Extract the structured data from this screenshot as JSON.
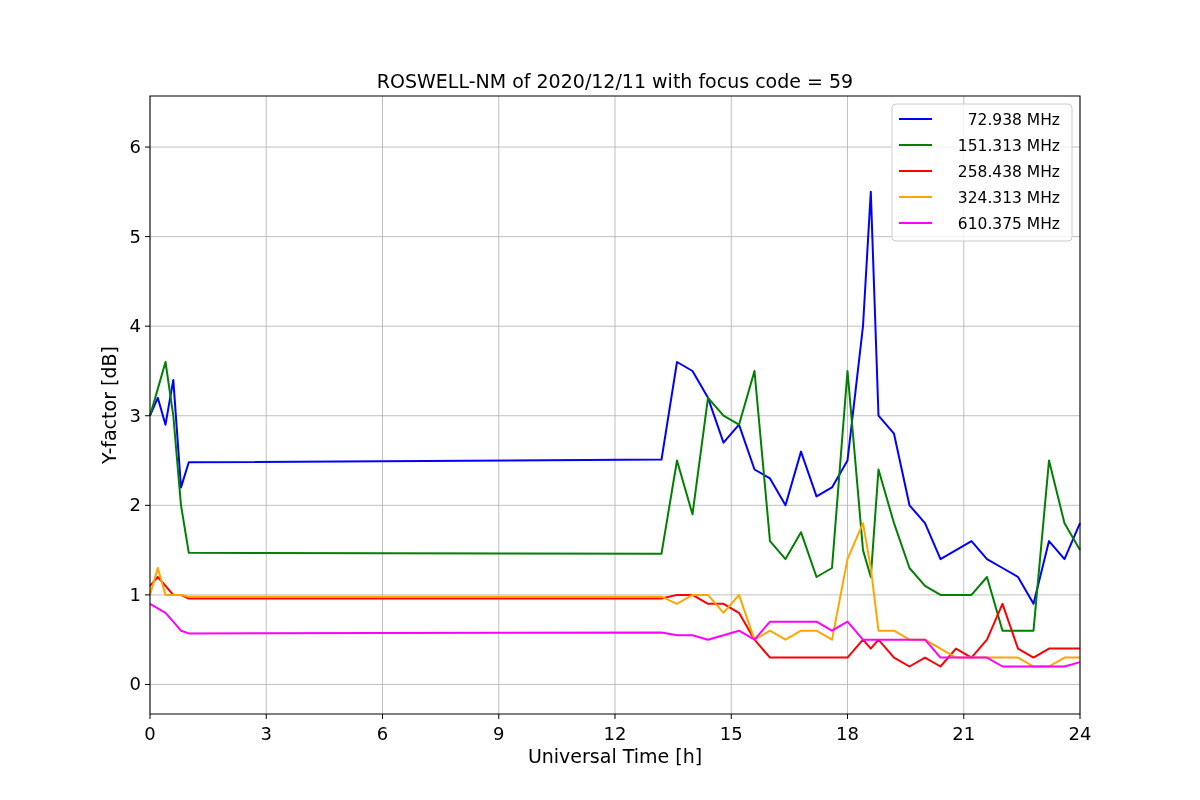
{
  "chart_data": {
    "type": "line",
    "title": "ROSWELL-NM of 2020/12/11 with focus code = 59",
    "xlabel": "Universal Time [h]",
    "ylabel": "Y-factor [dB]",
    "x": [
      0,
      0.2,
      0.4,
      0.6,
      0.8,
      1,
      13.2,
      13.6,
      14,
      14.4,
      14.8,
      15.2,
      15.6,
      16,
      16.4,
      16.8,
      17.2,
      17.6,
      18,
      18.4,
      18.6,
      18.8,
      19.2,
      19.6,
      20,
      20.4,
      20.8,
      21.2,
      21.6,
      22,
      22.4,
      22.8,
      23.2,
      23.6,
      24
    ],
    "series": [
      {
        "name": "72.938 MHz",
        "color": "#0000ff",
        "values": [
          3.0,
          3.2,
          2.9,
          3.4,
          2.2,
          2.48,
          2.51,
          3.6,
          3.5,
          3.2,
          2.7,
          2.9,
          2.4,
          2.3,
          2.0,
          2.6,
          2.1,
          2.2,
          2.5,
          4.0,
          5.5,
          3.0,
          2.8,
          2.0,
          1.8,
          1.4,
          1.5,
          1.6,
          1.4,
          1.3,
          1.2,
          0.9,
          1.6,
          1.4,
          1.8
        ]
      },
      {
        "name": "151.313 MHz",
        "color": "#008000",
        "values": [
          3.0,
          3.3,
          3.6,
          3.0,
          2.0,
          1.47,
          1.46,
          2.5,
          1.9,
          3.2,
          3.0,
          2.9,
          3.5,
          1.6,
          1.4,
          1.7,
          1.2,
          1.3,
          3.5,
          1.5,
          1.2,
          2.4,
          1.8,
          1.3,
          1.1,
          1.0,
          1.0,
          1.0,
          1.2,
          0.6,
          0.6,
          0.6,
          2.5,
          1.8,
          1.5
        ]
      },
      {
        "name": "258.438 MHz",
        "color": "#ff0000",
        "values": [
          1.1,
          1.2,
          1.1,
          1.0,
          1.0,
          0.96,
          0.96,
          1.0,
          1.0,
          0.9,
          0.9,
          0.8,
          0.5,
          0.3,
          0.3,
          0.3,
          0.3,
          0.3,
          0.3,
          0.5,
          0.4,
          0.5,
          0.3,
          0.2,
          0.3,
          0.2,
          0.4,
          0.3,
          0.5,
          0.9,
          0.4,
          0.3,
          0.4,
          0.4,
          0.4
        ]
      },
      {
        "name": "324.313 MHz",
        "color": "#ffa500",
        "values": [
          1.0,
          1.3,
          1.0,
          1.0,
          1.0,
          0.98,
          0.98,
          0.9,
          1.0,
          1.0,
          0.8,
          1.0,
          0.5,
          0.6,
          0.5,
          0.6,
          0.6,
          0.5,
          1.4,
          1.8,
          1.3,
          0.6,
          0.6,
          0.5,
          0.5,
          0.4,
          0.3,
          0.3,
          0.3,
          0.3,
          0.3,
          0.2,
          0.2,
          0.3,
          0.3
        ]
      },
      {
        "name": "610.375 MHz",
        "color": "#ff00ff",
        "values": [
          0.9,
          0.85,
          0.8,
          0.7,
          0.6,
          0.57,
          0.58,
          0.55,
          0.55,
          0.5,
          0.55,
          0.6,
          0.5,
          0.7,
          0.7,
          0.7,
          0.7,
          0.6,
          0.7,
          0.5,
          0.5,
          0.5,
          0.5,
          0.5,
          0.5,
          0.3,
          0.3,
          0.3,
          0.3,
          0.2,
          0.2,
          0.2,
          0.2,
          0.2,
          0.25
        ]
      }
    ],
    "xlim": [
      0,
      24
    ],
    "ylim": [
      -0.33,
      6.57
    ],
    "xticks": [
      0,
      3,
      6,
      9,
      12,
      15,
      18,
      21,
      24
    ],
    "yticks": [
      0,
      1,
      2,
      3,
      4,
      5,
      6
    ],
    "grid": true,
    "legend": true
  }
}
